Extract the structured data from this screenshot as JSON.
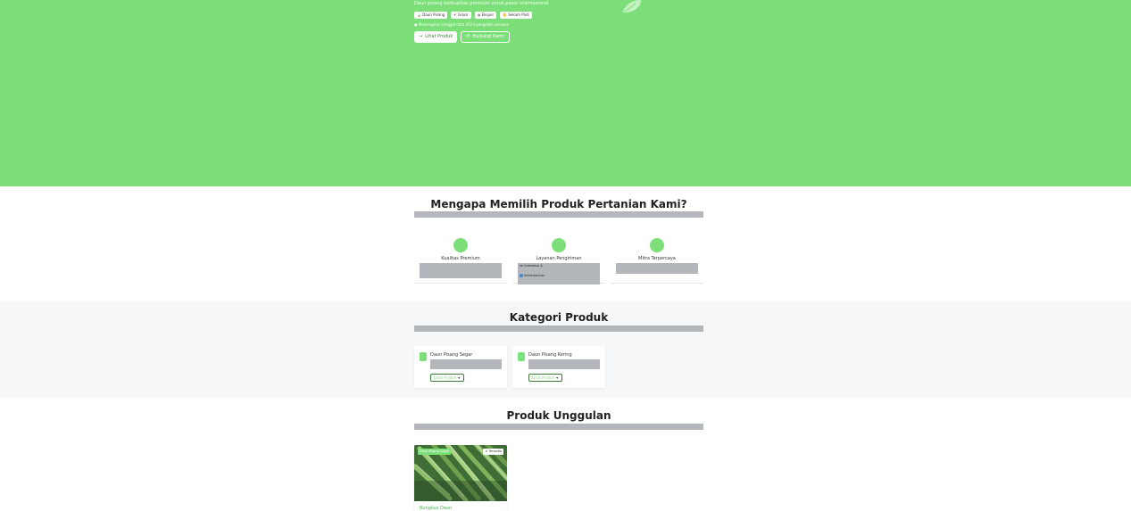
{
  "hero": {
    "subtitle": "Daun pisang berkualitas premium untuk pasar internasional",
    "tags": [
      {
        "icon": "leaf-icon",
        "label": "Daun Pisang"
      },
      {
        "icon": "check-icon",
        "label": "Grosir"
      },
      {
        "icon": "globe-icon",
        "label": "Ekspor"
      },
      {
        "icon": "handshake-icon",
        "label": "Sekam Padi"
      }
    ],
    "note": "Menerapkan tanggal data 2023 pengelola serapan",
    "primary_button": "Lihat Produk",
    "secondary_button": "Hubungi Kami",
    "bg_color": "#7ddf79"
  },
  "why": {
    "title": "Mengapa Memilih Produk Pertanian Kami?",
    "features": [
      {
        "title": "Kualitas Premium",
        "icon": "award-icon"
      },
      {
        "title": "Layanan Pengiriman",
        "icon": "truck-icon",
        "line1": "ke Indonesia &",
        "line2": "Internasional"
      },
      {
        "title": "Mitra Terpercaya",
        "icon": "handshake-icon"
      }
    ]
  },
  "categories": {
    "title": "Kategori Produk",
    "items": [
      {
        "name": "Daun Pisang Segar",
        "link": "Lihat Produk"
      },
      {
        "name": "Daun Pisang Kering",
        "link": "Lihat Produk"
      }
    ]
  },
  "products": {
    "title": "Produk Unggulan",
    "items": [
      {
        "badge": "Daun Pisang Segar",
        "stock": "Tersedia",
        "name": "Bungkus Daun"
      }
    ]
  },
  "colors": {
    "accent": "#7ddf79",
    "placeholder": "#b3b7bc",
    "dark_green": "#3a7d37"
  }
}
